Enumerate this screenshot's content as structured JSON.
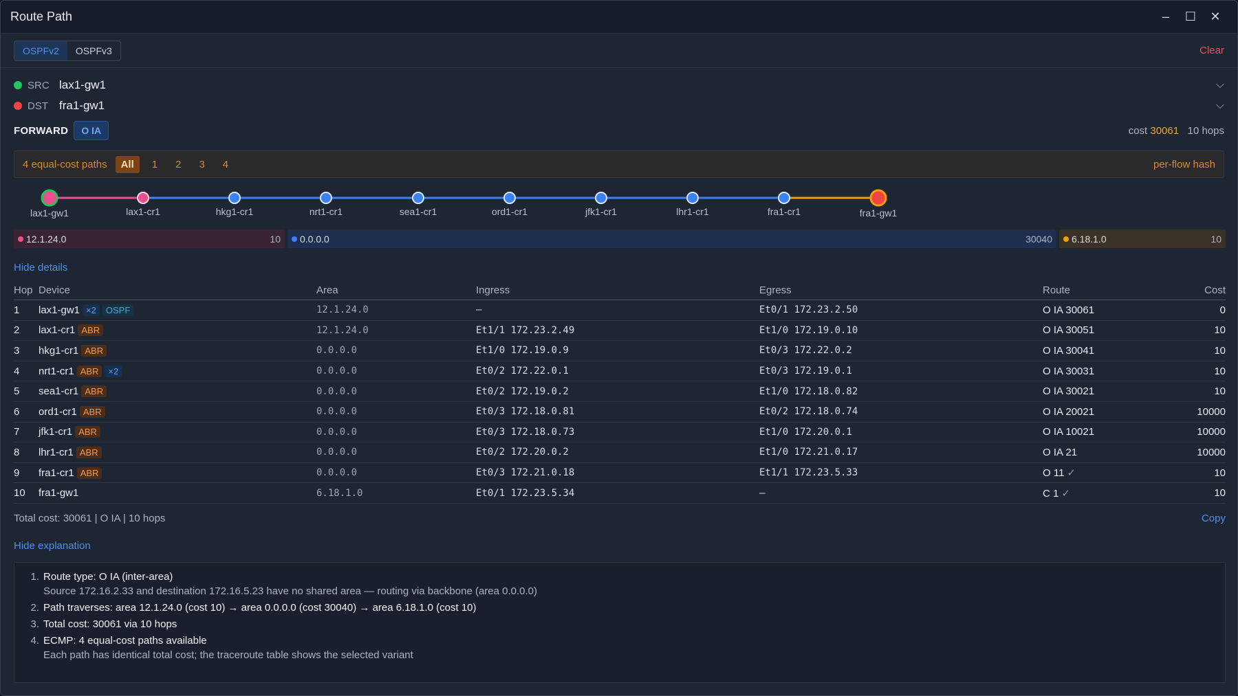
{
  "window": {
    "title": "Route Path",
    "minimize": "–",
    "maximize": "☐",
    "close": "✕"
  },
  "toolbar": {
    "tabs": [
      "OSPFv2",
      "OSPFv3"
    ],
    "active_tab": "OSPFv2",
    "clear_label": "Clear"
  },
  "src": {
    "label": "SRC",
    "value": "lax1-gw1",
    "color": "#22c55e"
  },
  "dst": {
    "label": "DST",
    "value": "fra1-gw1",
    "color": "#ef4444"
  },
  "forward": {
    "label": "FORWARD",
    "route_type": "O IA",
    "cost_prefix": "cost",
    "cost_value": "30061",
    "hops": "10 hops"
  },
  "ecmp": {
    "text": "4 equal-cost paths",
    "options": [
      "All",
      "1",
      "2",
      "3",
      "4"
    ],
    "active": "All",
    "hash": "per-flow hash"
  },
  "path_nodes": [
    "lax1-gw1",
    "lax1-cr1",
    "hkg1-cr1",
    "nrt1-cr1",
    "sea1-cr1",
    "ord1-cr1",
    "jfk1-cr1",
    "lhr1-cr1",
    "fra1-cr1",
    "fra1-gw1"
  ],
  "areas": [
    {
      "name": "12.1.24.0",
      "cost": "10",
      "color": "#ec4f8f"
    },
    {
      "name": "0.0.0.0",
      "cost": "30040",
      "color": "#3b82f6"
    },
    {
      "name": "6.18.1.0",
      "cost": "10",
      "color": "#f59e0b"
    }
  ],
  "details_toggle": "Hide details",
  "table": {
    "headers": [
      "Hop",
      "Device",
      "Area",
      "Ingress",
      "Egress",
      "Route",
      "Cost"
    ],
    "rows": [
      {
        "hop": "1",
        "device": "lax1-gw1",
        "tags": [
          "×2",
          "OSPF"
        ],
        "area": "12.1.24.0",
        "ingress": "—",
        "egress": "Et0/1 172.23.2.50",
        "route": "O IA 30061",
        "check": "",
        "cost": "0"
      },
      {
        "hop": "2",
        "device": "lax1-cr1",
        "tags": [
          "ABR"
        ],
        "area": "12.1.24.0",
        "ingress": "Et1/1 172.23.2.49",
        "egress": "Et1/0 172.19.0.10",
        "route": "O IA 30051",
        "check": "",
        "cost": "10"
      },
      {
        "hop": "3",
        "device": "hkg1-cr1",
        "tags": [
          "ABR"
        ],
        "area": "0.0.0.0",
        "ingress": "Et1/0 172.19.0.9",
        "egress": "Et0/3 172.22.0.2",
        "route": "O IA 30041",
        "check": "",
        "cost": "10"
      },
      {
        "hop": "4",
        "device": "nrt1-cr1",
        "tags": [
          "ABR",
          "×2"
        ],
        "area": "0.0.0.0",
        "ingress": "Et0/2 172.22.0.1",
        "egress": "Et0/3 172.19.0.1",
        "route": "O IA 30031",
        "check": "",
        "cost": "10"
      },
      {
        "hop": "5",
        "device": "sea1-cr1",
        "tags": [
          "ABR"
        ],
        "area": "0.0.0.0",
        "ingress": "Et0/2 172.19.0.2",
        "egress": "Et1/0 172.18.0.82",
        "route": "O IA 30021",
        "check": "",
        "cost": "10"
      },
      {
        "hop": "6",
        "device": "ord1-cr1",
        "tags": [
          "ABR"
        ],
        "area": "0.0.0.0",
        "ingress": "Et0/3 172.18.0.81",
        "egress": "Et0/2 172.18.0.74",
        "route": "O IA 20021",
        "check": "",
        "cost": "10000"
      },
      {
        "hop": "7",
        "device": "jfk1-cr1",
        "tags": [
          "ABR"
        ],
        "area": "0.0.0.0",
        "ingress": "Et0/3 172.18.0.73",
        "egress": "Et1/0 172.20.0.1",
        "route": "O IA 10021",
        "check": "",
        "cost": "10000"
      },
      {
        "hop": "8",
        "device": "lhr1-cr1",
        "tags": [
          "ABR"
        ],
        "area": "0.0.0.0",
        "ingress": "Et0/2 172.20.0.2",
        "egress": "Et1/0 172.21.0.17",
        "route": "O IA 21",
        "check": "",
        "cost": "10000"
      },
      {
        "hop": "9",
        "device": "fra1-cr1",
        "tags": [
          "ABR"
        ],
        "area": "0.0.0.0",
        "ingress": "Et0/3 172.21.0.18",
        "egress": "Et1/1 172.23.5.33",
        "route": "O 11",
        "check": "✓",
        "cost": "10"
      },
      {
        "hop": "10",
        "device": "fra1-gw1",
        "tags": [],
        "area": "6.18.1.0",
        "ingress": "Et0/1 172.23.5.34",
        "egress": "—",
        "route": "C 1",
        "check": "✓",
        "cost": "10"
      }
    ]
  },
  "total": {
    "text": "Total cost: 30061 | O IA | 10 hops",
    "copy": "Copy"
  },
  "explanation_toggle": "Hide explanation",
  "explanation": [
    {
      "num": "1.",
      "main": "Route type: O IA (inter-area)",
      "sub": "Source 172.16.2.33 and destination 172.16.5.23 have no shared area — routing via backbone (area 0.0.0.0)"
    },
    {
      "num": "2.",
      "main": "Path traverses: area 12.1.24.0 (cost 10) → area 0.0.0.0 (cost 30040) → area 6.18.1.0 (cost 10)",
      "sub": ""
    },
    {
      "num": "3.",
      "main": "Total cost: 30061 via 10 hops",
      "sub": ""
    },
    {
      "num": "4.",
      "main": "ECMP: 4 equal-cost paths available",
      "sub": "Each path has identical total cost; the traceroute table shows the selected variant"
    }
  ]
}
